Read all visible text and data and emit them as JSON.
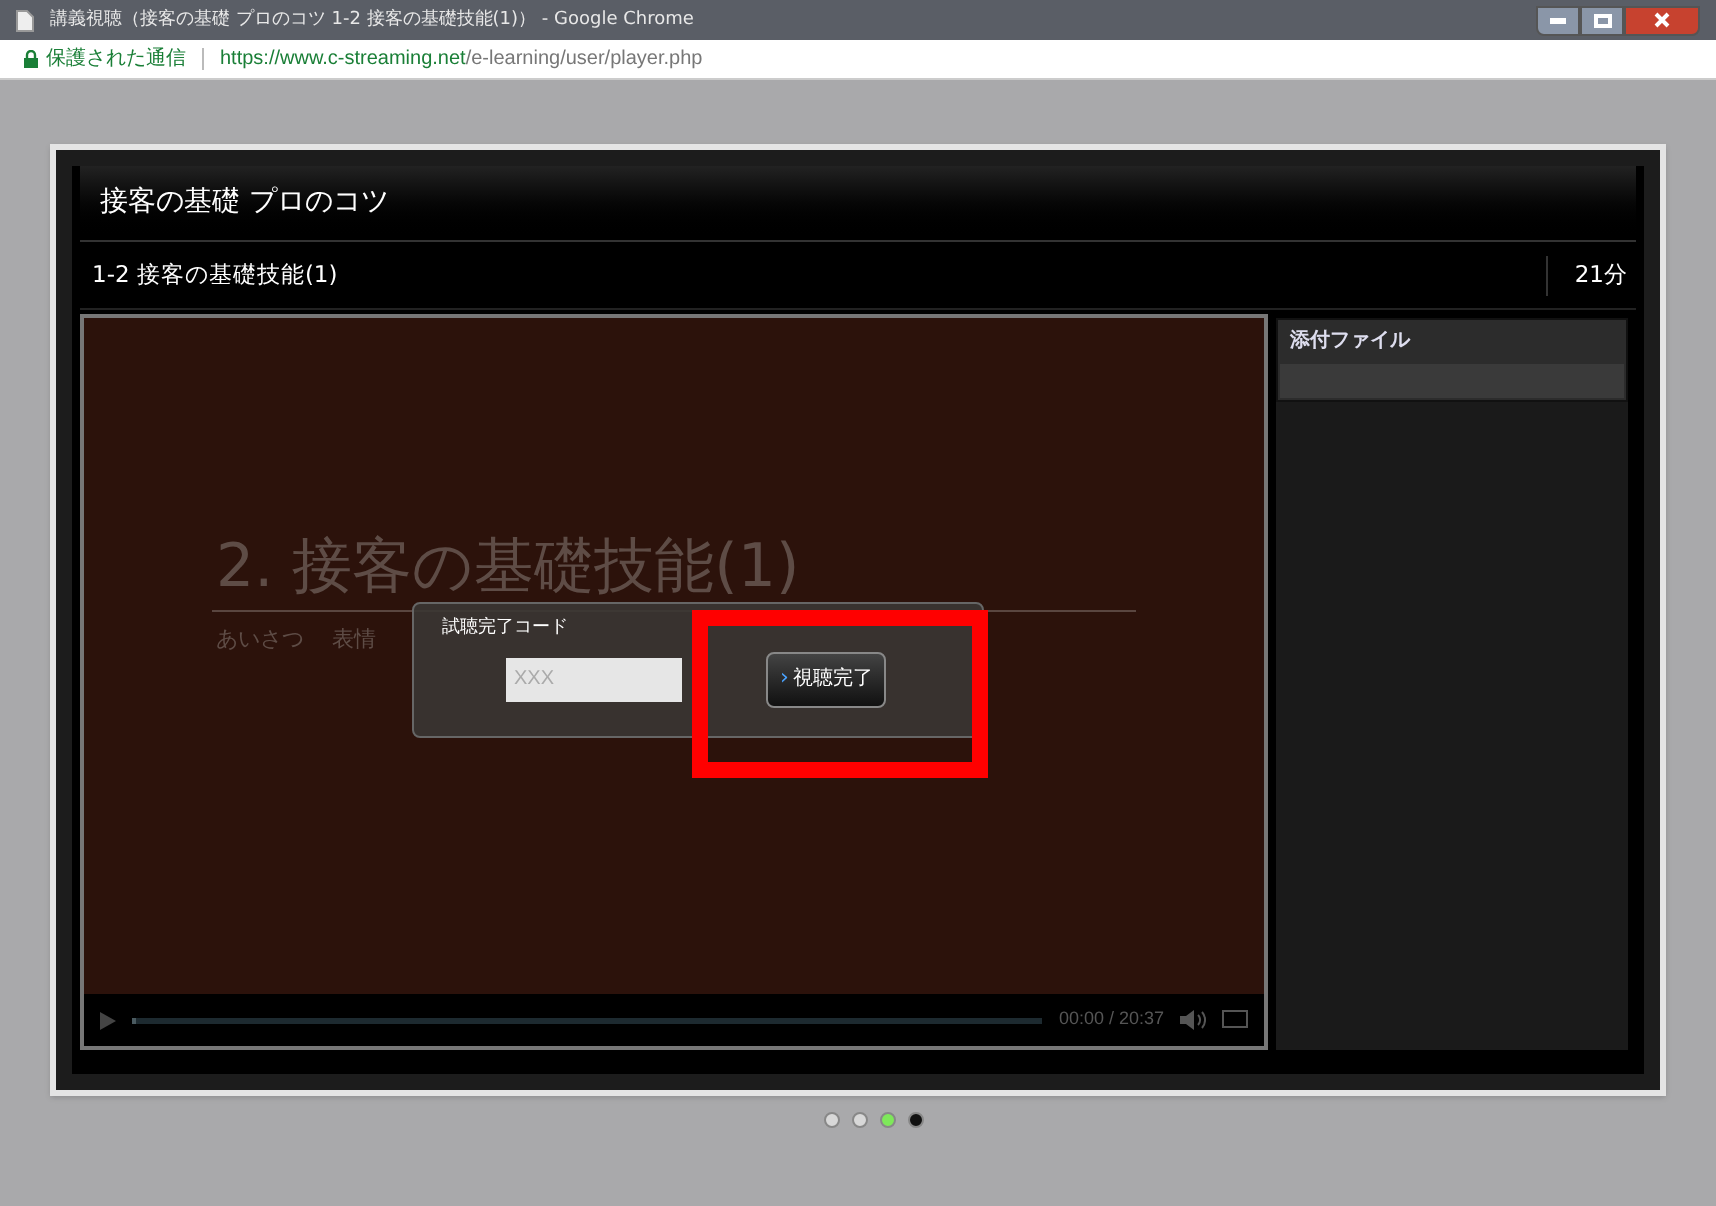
{
  "window": {
    "title": "講義視聴（接客の基礎 プロのコツ 1-2 接客の基礎技能(1)） - Google Chrome"
  },
  "address_bar": {
    "security": "保護された通信",
    "url_host": "https://www.c-streaming.net",
    "url_path": "/e-learning/user/player.php"
  },
  "course": {
    "title": "接客の基礎 プロのコツ",
    "lesson": "1-2 接客の基礎技能(1)",
    "duration": "21分"
  },
  "slide": {
    "title": "2. 接客の基礎技能(1)",
    "topics": [
      "あいさつ",
      "表情"
    ]
  },
  "dialog": {
    "label": "試聴完了コード",
    "code": "XXX",
    "button": "視聴完了",
    "button_icon": "›"
  },
  "player": {
    "level": 0,
    "time": "00:00 / 20:37"
  },
  "attachments": {
    "title": "添付ファイル"
  },
  "highlight": {
    "color": "#ff0000"
  },
  "pager": [
    {
      "color": "#d8d8d8"
    },
    {
      "color": "#d8d8d8"
    },
    {
      "color": "#7ee85a"
    },
    {
      "color": "#111111"
    }
  ]
}
